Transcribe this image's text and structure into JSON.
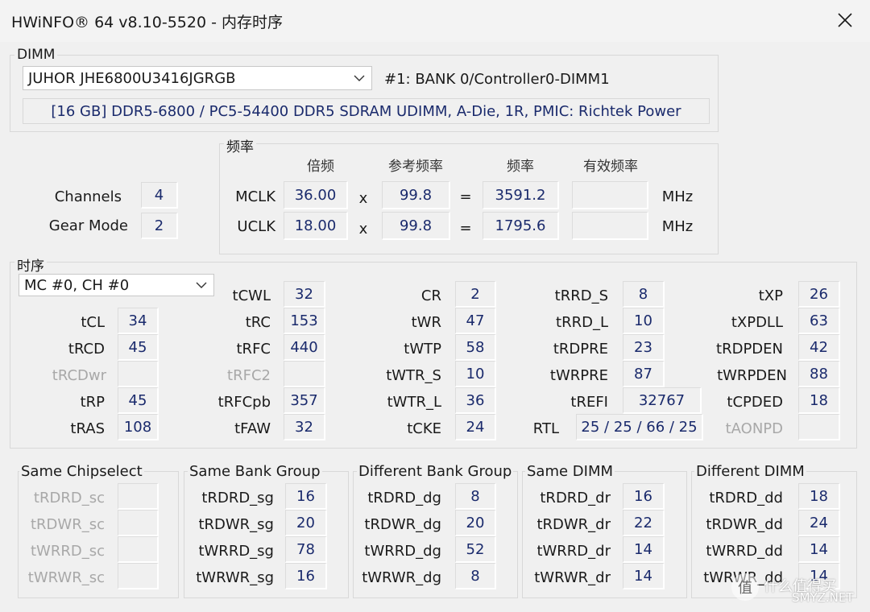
{
  "window": {
    "title": "HWiNFO® 64 v8.10-5520 - 内存时序"
  },
  "dimm": {
    "group_label": "DIMM",
    "module": "JUHOR JHE6800U3416JGRGB",
    "slot": "#1: BANK 0/Controller0-DIMM1",
    "description": "[16 GB] DDR5-6800 / PC5-54400 DDR5 SDRAM UDIMM, A-Die, 1R, PMIC: Richtek Power"
  },
  "left_info": {
    "channels_label": "Channels",
    "channels_value": "4",
    "gear_label": "Gear Mode",
    "gear_value": "2"
  },
  "freq": {
    "group_label": "频率",
    "headers": [
      "倍频",
      "参考频率",
      "频率",
      "有效频率"
    ],
    "x_sign": "x",
    "eq_sign": "=",
    "rows": [
      {
        "label": "MCLK",
        "mult": "36.00",
        "ref": "99.8",
        "freq": "3591.2",
        "eff": "",
        "unit": "MHz"
      },
      {
        "label": "UCLK",
        "mult": "18.00",
        "ref": "99.8",
        "freq": "1795.6",
        "eff": "",
        "unit": "MHz"
      }
    ]
  },
  "timing": {
    "group_label": "时序",
    "channel_select": "MC #0, CH #0",
    "col1": [
      {
        "label": "tCL",
        "value": "34"
      },
      {
        "label": "tRCD",
        "value": "45"
      },
      {
        "label": "tRCDwr",
        "value": ""
      },
      {
        "label": "tRP",
        "value": "45"
      },
      {
        "label": "tRAS",
        "value": "108"
      }
    ],
    "col2": [
      {
        "label": "tCWL",
        "value": "32"
      },
      {
        "label": "tRC",
        "value": "153"
      },
      {
        "label": "tRFC",
        "value": "440"
      },
      {
        "label": "tRFC2",
        "value": ""
      },
      {
        "label": "tRFCpb",
        "value": "357"
      },
      {
        "label": "tFAW",
        "value": "32"
      }
    ],
    "col3": [
      {
        "label": "CR",
        "value": "2"
      },
      {
        "label": "tWR",
        "value": "47"
      },
      {
        "label": "tWTP",
        "value": "58"
      },
      {
        "label": "tWTR_S",
        "value": "10"
      },
      {
        "label": "tWTR_L",
        "value": "36"
      },
      {
        "label": "tCKE",
        "value": "24"
      }
    ],
    "col4": [
      {
        "label": "tRRD_S",
        "value": "8"
      },
      {
        "label": "tRRD_L",
        "value": "10"
      },
      {
        "label": "tRDPRE",
        "value": "23"
      },
      {
        "label": "tWRPRE",
        "value": "87"
      },
      {
        "label": "tREFI",
        "value": "32767"
      },
      {
        "label": "RTL",
        "value": "25 / 25 / 66 / 25"
      }
    ],
    "col5": [
      {
        "label": "tXP",
        "value": "26"
      },
      {
        "label": "tXPDLL",
        "value": "63"
      },
      {
        "label": "tRDPDEN",
        "value": "42"
      },
      {
        "label": "tWRPDEN",
        "value": "88"
      },
      {
        "label": "tCPDED",
        "value": "18"
      },
      {
        "label": "tAONPD",
        "value": ""
      }
    ]
  },
  "turnaround": [
    {
      "title": "Same Chipselect",
      "rows": [
        {
          "label": "tRDRD_sc",
          "value": ""
        },
        {
          "label": "tRDWR_sc",
          "value": ""
        },
        {
          "label": "tWRRD_sc",
          "value": ""
        },
        {
          "label": "tWRWR_sc",
          "value": ""
        }
      ]
    },
    {
      "title": "Same Bank Group",
      "rows": [
        {
          "label": "tRDRD_sg",
          "value": "16"
        },
        {
          "label": "tRDWR_sg",
          "value": "20"
        },
        {
          "label": "tWRRD_sg",
          "value": "78"
        },
        {
          "label": "tWRWR_sg",
          "value": "16"
        }
      ]
    },
    {
      "title": "Different Bank Group",
      "rows": [
        {
          "label": "tRDRD_dg",
          "value": "8"
        },
        {
          "label": "tRDWR_dg",
          "value": "20"
        },
        {
          "label": "tWRRD_dg",
          "value": "52"
        },
        {
          "label": "tWRWR_dg",
          "value": "8"
        }
      ]
    },
    {
      "title": "Same DIMM",
      "rows": [
        {
          "label": "tRDRD_dr",
          "value": "16"
        },
        {
          "label": "tRDWR_dr",
          "value": "22"
        },
        {
          "label": "tWRRD_dr",
          "value": "14"
        },
        {
          "label": "tWRWR_dr",
          "value": "14"
        }
      ]
    },
    {
      "title": "Different DIMM",
      "rows": [
        {
          "label": "tRDRD_dd",
          "value": "18"
        },
        {
          "label": "tRDWR_dd",
          "value": "24"
        },
        {
          "label": "tWRRD_dd",
          "value": "14"
        },
        {
          "label": "tWRWR_dd",
          "value": "14"
        }
      ]
    }
  ],
  "watermark": {
    "text1": "值",
    "text2": "什么值得买",
    "text3": "SMYZ.NET"
  }
}
